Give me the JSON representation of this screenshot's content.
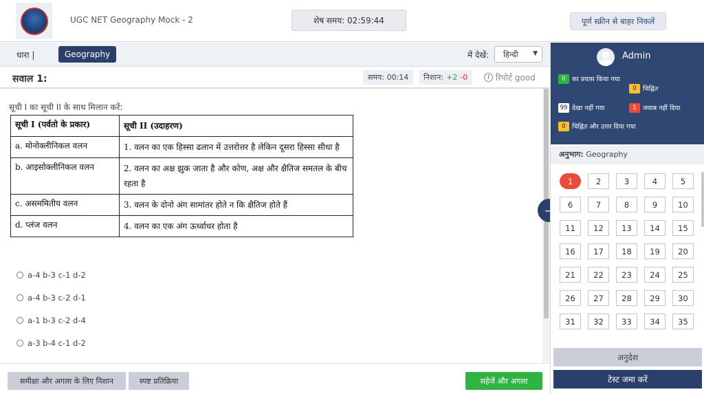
{
  "header": {
    "test_title": "UGC NET Geography Mock - 2",
    "timer_text": "शेष समय: 02:59:44",
    "fullscreen_label": "पूर्ण स्क्रीन से बाहर निकलें"
  },
  "section_bar": {
    "label": "धारा |",
    "active_section": "Geography",
    "view_in_label": "में देखें:",
    "language": "हिन्दी"
  },
  "question": {
    "number_label": "सवाल 1:",
    "time_label": "समय: 00:14",
    "marks_label": "निशान:",
    "marks_positive": "+2",
    "marks_negative": "-0",
    "report_label": "रिपोर्ट good",
    "instruction": "सूची I का सूची II के साथ मिलान करें:",
    "table": {
      "header_left": "सूची I (पर्वतो के प्रकार)",
      "header_right": "सूची II (उदाहरण)",
      "rows": [
        {
          "left": "a. मोनोक्लीनिकल वलन",
          "right": "1.  वलन का एक हिस्सा ढलान में उत्तरोत्तर है लेकिन दूसरा हिस्सा सीधा है"
        },
        {
          "left": "b. आइसोक्लीनिकल वलन",
          "right": "2. वलन का अक्ष झुक जाता है और कोण, अक्ष और क्षैतिज समतल के बीच रहता है"
        },
        {
          "left": "c. असममितीय वलन",
          "right": "3. वलन के दोनो अंग सामांतर होते न कि क्षैतिज होते हैं"
        },
        {
          "left": "d. प्लंज वलन",
          "right": "4. वलन का एक अंग ऊर्ध्वाधर होता है"
        }
      ]
    },
    "options": [
      "a-4 b-3 c-1 d-2",
      "a-4 b-3 c-2 d-1",
      "a-1 b-3 c-2 d-4",
      "a-3 b-4 c-1 d-2"
    ]
  },
  "footer": {
    "mark_review_label": "समीक्षा और अगला के लिए निशान",
    "clear_label": "स्पष्ट प्रतिक्रिया",
    "save_next_label": "सहेजें और अगला"
  },
  "panel": {
    "username": "Admin",
    "legend": {
      "answered_count": "0",
      "answered_label": "का प्रयास किया गया",
      "marked_count": "0",
      "marked_label": "चिह्नित",
      "not_visited_count": "99",
      "not_visited_label": "देखा नहीं गया",
      "not_answered_count": "1",
      "not_answered_label": "जवाब नहीं दिया",
      "marked_answered_count": "0",
      "marked_answered_label": "चिह्नित और उत्तर दिया गया"
    },
    "section_prefix": "अनुभाग:",
    "section_name": "Geography",
    "question_numbers": [
      "1",
      "2",
      "3",
      "4",
      "5",
      "6",
      "7",
      "8",
      "9",
      "10",
      "11",
      "12",
      "13",
      "14",
      "15",
      "16",
      "17",
      "18",
      "19",
      "20",
      "21",
      "22",
      "23",
      "24",
      "25",
      "26",
      "27",
      "28",
      "29",
      "30",
      "31",
      "32",
      "33",
      "34",
      "35"
    ],
    "current_question": "1",
    "instructions_label": "अनुदेश",
    "submit_label": "टेस्ट जमा करें"
  }
}
